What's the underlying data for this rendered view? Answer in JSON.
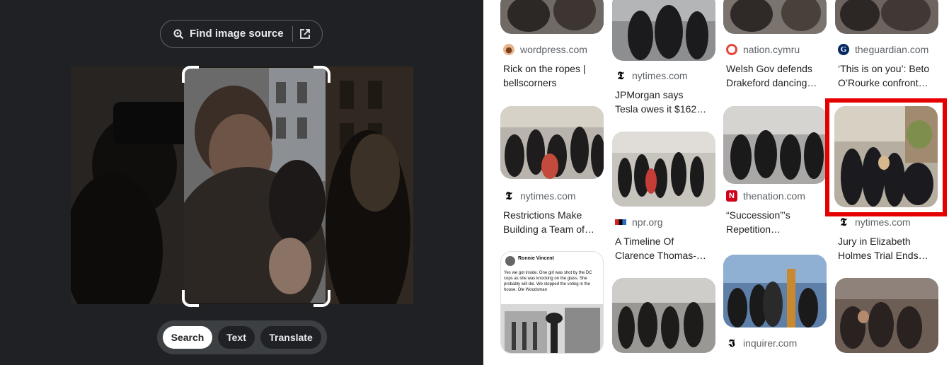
{
  "lens": {
    "find_source_label": "Find image source",
    "tabs": [
      {
        "label": "Search",
        "active": true
      },
      {
        "label": "Text",
        "active": false
      },
      {
        "label": "Translate",
        "active": false
      }
    ]
  },
  "results": [
    {
      "source": "wordpress.com",
      "title": [
        "Rick on the ropes |",
        "bellscorners"
      ]
    },
    {
      "source": "nytimes.com",
      "title": [
        "JPMorgan says",
        "Tesla owes it $162…"
      ]
    },
    {
      "source": "nation.cymru",
      "title": [
        "Welsh Gov defends",
        "Drakeford dancing…"
      ]
    },
    {
      "source": "theguardian.com",
      "title": [
        "‘This is on you’: Beto",
        "O’Rourke confront…"
      ]
    },
    {
      "source": "nytimes.com",
      "title": [
        "Restrictions Make",
        "Building a Team of…"
      ]
    },
    {
      "source": "npr.org",
      "title": [
        "A Timeline Of",
        "Clarence Thomas-…"
      ]
    },
    {
      "source": "thenation.com",
      "title": [
        "“Succession”’s",
        "Repetition…"
      ]
    },
    {
      "source": "nytimes.com",
      "title": [
        "Jury in Elizabeth",
        "Holmes Trial Ends…"
      ]
    },
    {
      "source": "inquirer.com",
      "title": []
    }
  ],
  "social_post": {
    "author": "Ronnie Vincent",
    "text": "Yes we got inside. One girl was shot by the DC cops as she was knocking on the glass. She probably will die. We stopped the voting in the house. Ole Woodsman"
  },
  "colors": {
    "highlight": "#e50000",
    "dark_bg": "#202124"
  }
}
